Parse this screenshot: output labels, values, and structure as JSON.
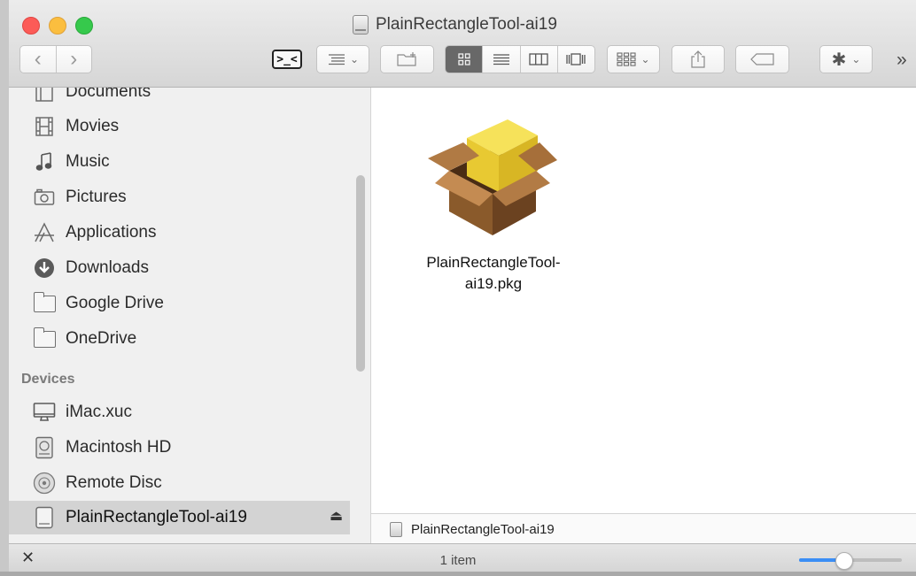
{
  "window": {
    "title": "PlainRectangleTool-ai19"
  },
  "toolbar": {
    "more_label": "»",
    "view_dropdown_caret": "⌄",
    "arrange_caret": "⌄",
    "action_caret": "⌄"
  },
  "sidebar": {
    "favorites": [
      {
        "label": "Documents",
        "icon": "documents-icon"
      },
      {
        "label": "Movies",
        "icon": "movies-icon"
      },
      {
        "label": "Music",
        "icon": "music-icon"
      },
      {
        "label": "Pictures",
        "icon": "pictures-icon"
      },
      {
        "label": "Applications",
        "icon": "applications-icon"
      },
      {
        "label": "Downloads",
        "icon": "downloads-icon"
      },
      {
        "label": "Google Drive",
        "icon": "folder-icon"
      },
      {
        "label": "OneDrive",
        "icon": "folder-icon"
      }
    ],
    "devices_header": "Devices",
    "devices": [
      {
        "label": "iMac.xuc",
        "icon": "imac-icon"
      },
      {
        "label": "Macintosh HD",
        "icon": "hard-disk-icon"
      },
      {
        "label": "Remote Disc",
        "icon": "remote-disc-icon"
      },
      {
        "label": "PlainRectangleTool-ai19",
        "icon": "disk-image-icon",
        "selected": true
      }
    ],
    "eject_symbol": "⏏"
  },
  "content": {
    "files": [
      {
        "name_line1": "PlainRectangleTool-",
        "name_line2": "ai19.pkg",
        "icon": "package-icon"
      }
    ]
  },
  "pathbar": {
    "label": "PlainRectangleTool-ai19"
  },
  "statusbar": {
    "item_count": "1 item",
    "icon_size_fraction": 0.42
  },
  "colors": {
    "close": "#fc5b57",
    "minimize": "#fbbe3f",
    "maximize": "#36c94c",
    "slider_accent": "#3b8ef5",
    "selection": "#d3d3d3"
  }
}
